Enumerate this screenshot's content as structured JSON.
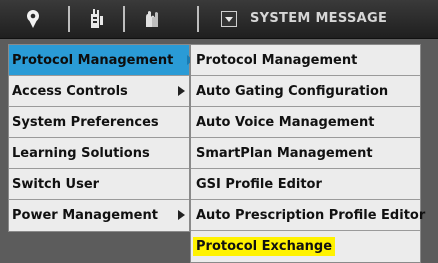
{
  "toolbar": {
    "icons": [
      "location-pin-icon",
      "phone-antenna-icon",
      "gloves-icon"
    ],
    "system_message_label": "SYSTEM MESSAGE"
  },
  "main_menu": {
    "items": [
      {
        "label": "Protocol Management",
        "has_submenu": true,
        "active": true
      },
      {
        "label": "Access Controls",
        "has_submenu": true,
        "active": false
      },
      {
        "label": "System Preferences",
        "has_submenu": false,
        "active": false
      },
      {
        "label": "Learning Solutions",
        "has_submenu": false,
        "active": false
      },
      {
        "label": "Switch User",
        "has_submenu": false,
        "active": false
      },
      {
        "label": "Power Management",
        "has_submenu": true,
        "active": false
      }
    ]
  },
  "submenu": {
    "items": [
      {
        "label": "Protocol Management"
      },
      {
        "label": "Auto Gating Configuration"
      },
      {
        "label": "Auto Voice Management"
      },
      {
        "label": "SmartPlan Management"
      },
      {
        "label": "GSI Profile Editor"
      },
      {
        "label": "Auto Prescription Profile Editor"
      },
      {
        "label": "Protocol Exchange",
        "highlighted": true
      }
    ]
  },
  "colors": {
    "active_item": "#2a9bd6",
    "highlight": "#fff200"
  }
}
